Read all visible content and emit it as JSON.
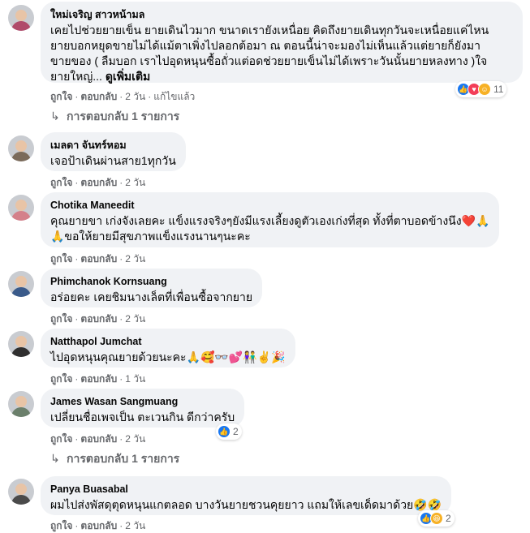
{
  "actions": {
    "like": "ถูกใจ",
    "reply": "ตอบกลับ",
    "sep": "·"
  },
  "comments": [
    {
      "author": "ใหม่เจริญ สาวหน้ามล",
      "lines": [
        "เคยไปช่วยยายเข็น ยายเดินไวมาก ขนาดเรายังเหนื่อย คิดถึงยายเดินทุกวันจะเหนื่อยแค่ไหน",
        "ยายบอกหยุดขายไม่ได้แม้ตาเพิ่งไปลอกต้อมา ณ ตอนนี้น่าจะมองไม่เห็นแล้วแต่ยายก็ยังมา",
        "ขายของ ( ลืมบอก เราไปอุดหนุนซื้อถั่วแต่อดช่วยยายเข็นไม่ได้เพราะวันนั้นยายหลงทาง )ใจ",
        "ยายใหญ่... "
      ],
      "see_more": "ดูเพิ่มเติม",
      "time": "2 วัน",
      "edited": "แก้ไขแล้ว",
      "reaction_count": "11",
      "reply_count": "การตอบกลับ 1 รายการ"
    },
    {
      "author": "เมลดา จันทร์หอม",
      "lines": [
        "เจอป้าเดินผ่านสาย1ทุกวัน"
      ],
      "time": "2 วัน"
    },
    {
      "author": "Chotika Maneedit",
      "lines": [
        "คุณยายขา เก่งจังเลยคะ แข็งแรงจริงๆยังมีแรงเลี้ยงดูตัวเองเก่งที่สุด ทั้งที่ตาบอดข้างนึง❤️🙏",
        "🙏ขอให้ยายมีสุขภาพแข็งแรงนานๆนะคะ"
      ],
      "time": "2 วัน"
    },
    {
      "author": "Phimchanok Kornsuang",
      "lines": [
        "อร่อยคะ เคยชิมนางเล็ตที่เพื่อนซื้อจากยาย"
      ],
      "time": "2 วัน"
    },
    {
      "author": "Natthapol Jumchat",
      "lines": [
        "ไปอุดหนุนคุณยายด้วยนะคะ🙏🥰👓💕👫✌️🎉"
      ],
      "time": "1 วัน"
    },
    {
      "author": "James Wasan Sangmuang",
      "lines": [
        "เปลี่ยนชื่อเพจเป็น ตะเวนกิน ดีกว่าครับ"
      ],
      "time": "2 วัน",
      "reaction_count": "2",
      "reply_count": "การตอบกลับ 1 รายการ"
    },
    {
      "author": "Panya Buasabal",
      "lines": [
        "ผมไปส่งพัสดุตุดหนุนแกตลอด บางวันยายชวนคุยยาว แถมให้เลขเด็ดมาด้วย🤣🤣"
      ],
      "time": "2 วัน",
      "reaction_count": "2"
    }
  ],
  "colors": {
    "bubble": "#f0f2f5",
    "meta": "#65676b",
    "like": "#1877f2",
    "love": "#f33e58",
    "haha": "#f7b125"
  }
}
